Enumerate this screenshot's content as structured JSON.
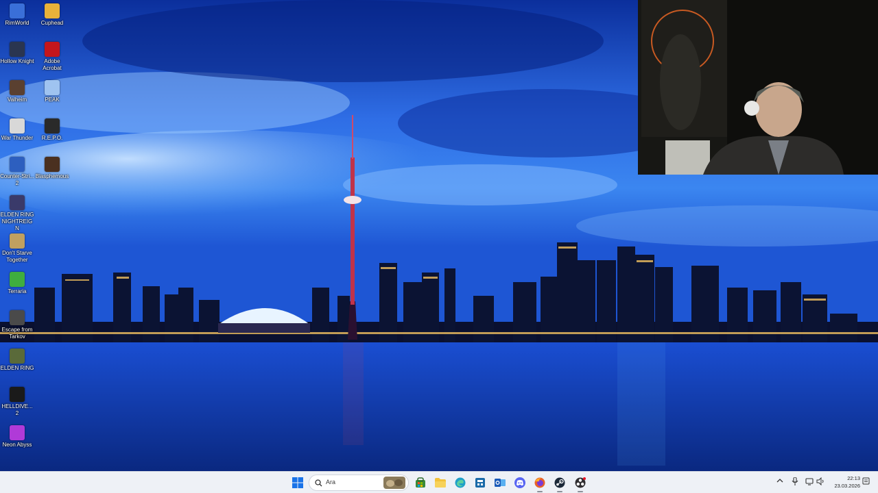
{
  "desktop": {
    "icons": [
      {
        "label": "RimWorld",
        "icon": "rimworld-icon",
        "color": "#3a6fd8"
      },
      {
        "label": "Cuphead",
        "icon": "cuphead-icon",
        "color": "#e8b23a"
      },
      {
        "label": "Hollow Knight",
        "icon": "hollow-knight-icon",
        "color": "#2a3550"
      },
      {
        "label": "Adobe Acrobat",
        "icon": "adobe-acrobat-icon",
        "color": "#c4161c"
      },
      {
        "label": "Valheim",
        "icon": "valheim-icon",
        "color": "#5a4030"
      },
      {
        "label": "PEAK",
        "icon": "peak-icon",
        "color": "#9fc3f0"
      },
      {
        "label": "War Thunder",
        "icon": "war-thunder-icon",
        "color": "#d8d8d8"
      },
      {
        "label": "R.E.P.O.",
        "icon": "repo-icon",
        "color": "#2a2a2a"
      },
      {
        "label": "Counter-Stri... 2",
        "icon": "counter-strike-icon",
        "color": "#2d5fbf"
      },
      {
        "label": "Blasphemous",
        "icon": "blasphemous-icon",
        "color": "#4a3020"
      },
      {
        "label": "ELDEN RING NIGHTREIGN",
        "icon": "elden-ring-nightreign-icon",
        "color": "#3a3a6a"
      },
      {
        "label": "Don't Starve Together",
        "icon": "dont-starve-together-icon",
        "color": "#c0a060"
      },
      {
        "label": "Terraria",
        "icon": "terraria-icon",
        "color": "#3fae3f"
      },
      {
        "label": "Escape from Tarkov",
        "icon": "escape-from-tarkov-icon",
        "color": "#4a4a4a"
      },
      {
        "label": "ELDEN RING",
        "icon": "elden-ring-icon",
        "color": "#5a6a3a"
      },
      {
        "label": "HELLDIVE... 2",
        "icon": "helldivers-icon",
        "color": "#1a1a1a"
      },
      {
        "label": "Neon Abyss",
        "icon": "neon-abyss-icon",
        "color": "#b03ad8"
      }
    ]
  },
  "taskbar": {
    "search_placeholder": "Ara",
    "apps": [
      {
        "name": "start-button",
        "icon": "windows-start-icon",
        "color": "#1a73e8"
      },
      {
        "name": "widgets",
        "icon": "widgets-icon",
        "color": "#8a7a5a"
      },
      {
        "name": "store",
        "icon": "store-icon",
        "color": "#3a8a3a"
      },
      {
        "name": "file-explorer",
        "icon": "folder-icon",
        "color": "#f2c23a"
      },
      {
        "name": "edge",
        "icon": "edge-icon",
        "color": "#1fa0c8"
      },
      {
        "name": "calculator",
        "icon": "app-icon",
        "color": "#1a6aa8"
      },
      {
        "name": "outlook",
        "icon": "outlook-icon",
        "color": "#1a5ab8"
      },
      {
        "name": "discord",
        "icon": "discord-icon",
        "color": "#5865f2"
      },
      {
        "name": "firefox",
        "icon": "firefox-icon",
        "color": "#e8622a"
      },
      {
        "name": "steam",
        "icon": "steam-icon",
        "color": "#1b2838"
      },
      {
        "name": "obs",
        "icon": "obs-icon",
        "color": "#302e31"
      }
    ],
    "time": "22:13",
    "date": "23.03.2026"
  }
}
